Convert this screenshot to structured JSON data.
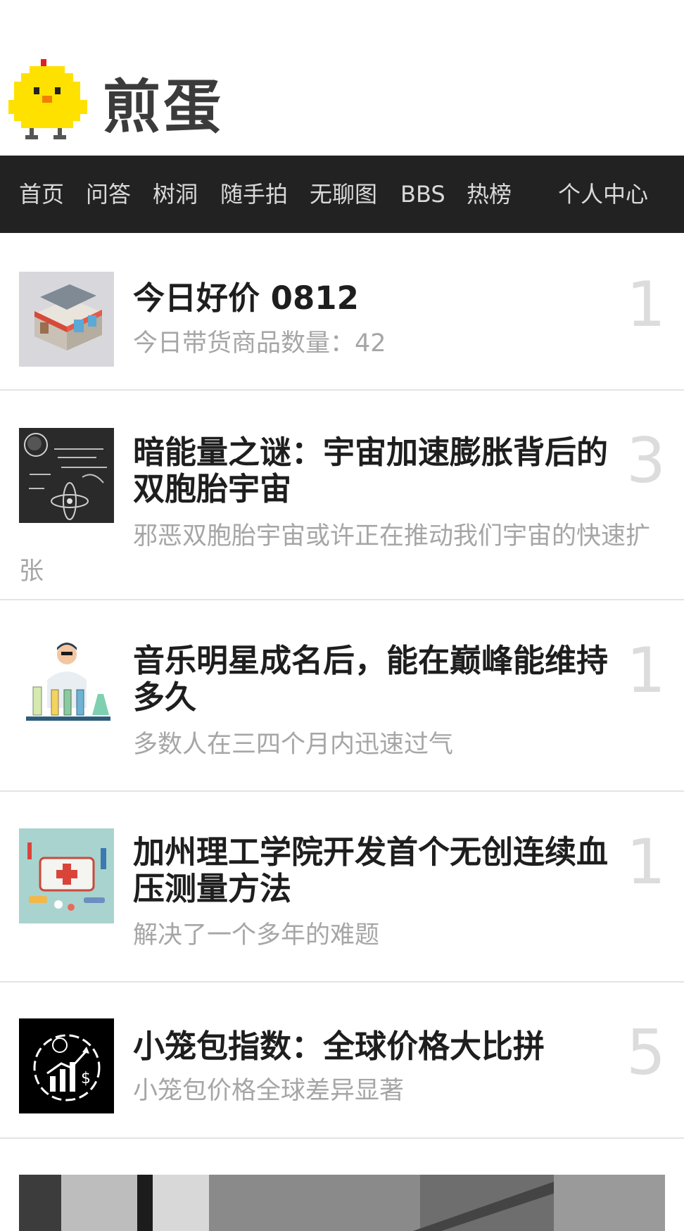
{
  "site": {
    "logo_text": "煎蛋"
  },
  "nav": {
    "items": [
      "首页",
      "问答",
      "树洞",
      "随手拍",
      "无聊图",
      "BBS",
      "热榜"
    ],
    "user_center": "个人中心"
  },
  "posts": [
    {
      "title": "今日好价 0812",
      "summary": "今日带货商品数量：42",
      "comments": "1",
      "thumb_icon": "storefront-illustration"
    },
    {
      "title": "暗能量之谜：宇宙加速膨胀背后的双胞胎宇宙",
      "summary": "邪恶双胞胎宇宙或许正在推动我们宇宙的快速扩张",
      "comments": "3",
      "thumb_icon": "chalkboard-physics-illustration"
    },
    {
      "title": "音乐明星成名后，能在巅峰能维持多久",
      "summary": "多数人在三四个月内迅速过气",
      "comments": "1",
      "thumb_icon": "scientist-lab-illustration"
    },
    {
      "title": "加州理工学院开发首个无创连续血压测量方法",
      "summary": "解决了一个多年的难题",
      "comments": "1",
      "thumb_icon": "medical-kit-illustration"
    },
    {
      "title": "小笼包指数：全球价格大比拼",
      "summary": "小笼包价格全球差异显著",
      "comments": "5",
      "thumb_icon": "price-chart-illustration"
    }
  ],
  "colors": {
    "nav_bg": "#222222",
    "nav_text": "#d9d9d9",
    "title": "#1e1e1e",
    "summary": "#a6a6a6",
    "count": "#dcdcdc"
  }
}
